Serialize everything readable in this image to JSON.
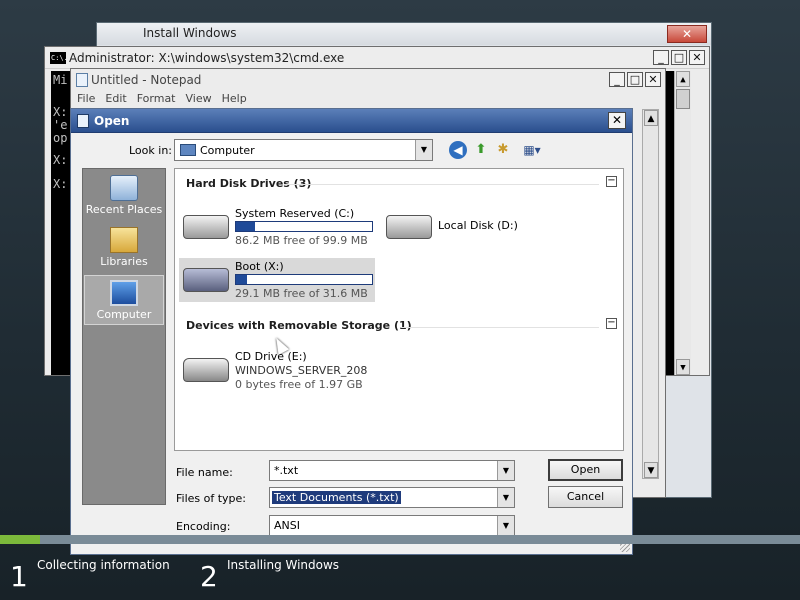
{
  "setup_window": {
    "title": "Install Windows",
    "close": "✕"
  },
  "cmd_window": {
    "title": "Administrator: X:\\windows\\system32\\cmd.exe",
    "icon_text": "C:\\.",
    "buttons": {
      "min": "_",
      "max": "□",
      "close": "✕"
    },
    "lines": [
      "Mi",
      "X:",
      "'e",
      "op",
      "X:",
      "X:"
    ]
  },
  "notepad": {
    "title": "Untitled - Notepad",
    "buttons": {
      "min": "_",
      "max": "□",
      "close": "✕"
    },
    "menu": [
      "File",
      "Edit",
      "Format",
      "View",
      "Help"
    ]
  },
  "open_dialog": {
    "title": "Open",
    "close": "✕",
    "look_in_label": "Look in:",
    "look_in_value": "Computer",
    "places": [
      {
        "label": "Recent Places",
        "icon": "recent-places-icon"
      },
      {
        "label": "Libraries",
        "icon": "libraries-icon"
      },
      {
        "label": "Computer",
        "icon": "computer-icon"
      }
    ],
    "groups": {
      "hard_disks": {
        "title": "Hard Disk Drives (3)",
        "drives": [
          {
            "name": "System Reserved (C:)",
            "free": "86.2 MB free of 99.9 MB",
            "used_fraction": 0.14
          },
          {
            "name": "Local Disk (D:)"
          },
          {
            "name": "Boot (X:)",
            "free": "29.1 MB free of 31.6 MB",
            "used_fraction": 0.08
          }
        ]
      },
      "removable": {
        "title": "Devices with Removable Storage (1)",
        "drives": [
          {
            "name": "CD Drive (E:)",
            "label": "WINDOWS_SERVER_208",
            "free": "0 bytes free of 1.97 GB"
          }
        ]
      }
    },
    "file_name_label": "File name:",
    "file_name_value": "*.txt",
    "file_type_label": "Files of type:",
    "file_type_value": "Text Documents (*.txt)",
    "encoding_label": "Encoding:",
    "encoding_value": "ANSI",
    "open_button": "Open",
    "cancel_button": "Cancel"
  },
  "setup_progress": {
    "fraction": 0.05,
    "steps": [
      {
        "num": "1",
        "label": "Collecting information"
      },
      {
        "num": "2",
        "label": "Installing Windows"
      }
    ]
  },
  "colors": {
    "accent": "#1f4a98",
    "progress": "#7cb93b",
    "title_blue": "#2a4f8e"
  }
}
